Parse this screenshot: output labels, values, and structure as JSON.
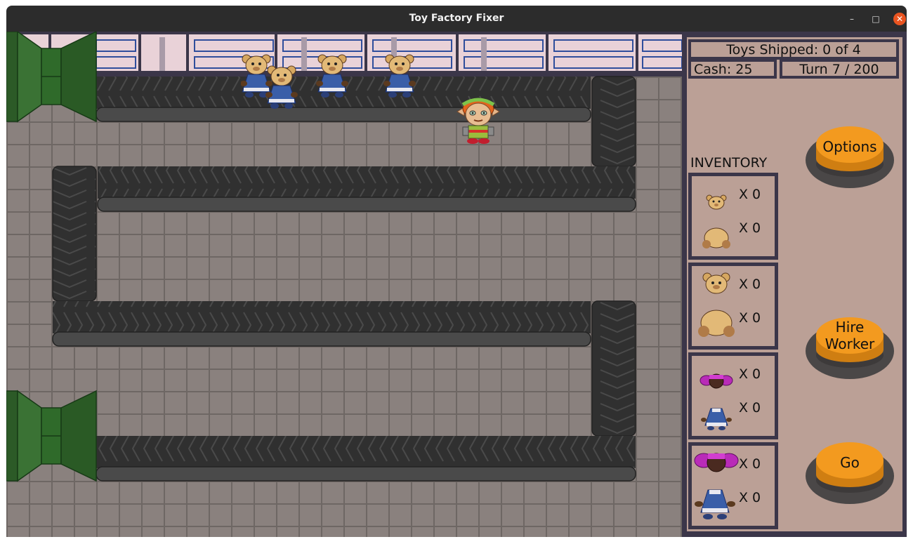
{
  "window": {
    "title": "Toy Factory Fixer",
    "minimize": "–",
    "maximize": "□",
    "close": "✕"
  },
  "hud": {
    "toys_shipped": "Toys Shipped: 0 of 4",
    "cash": "Cash: 25",
    "turn": "Turn 7 / 200",
    "inventory_title": "INVENTORY",
    "inventory": [
      {
        "items": [
          {
            "icon": "small-bear-head-icon",
            "count": "X 0"
          },
          {
            "icon": "small-bear-body-icon",
            "count": "X 0"
          }
        ]
      },
      {
        "items": [
          {
            "icon": "bear-head-icon",
            "count": "X 0"
          },
          {
            "icon": "bear-body-icon",
            "count": "X 0"
          }
        ]
      },
      {
        "items": [
          {
            "icon": "small-doll-head-icon",
            "count": "X 0"
          },
          {
            "icon": "small-doll-dress-icon",
            "count": "X 0"
          }
        ]
      },
      {
        "items": [
          {
            "icon": "doll-head-icon",
            "count": "X 0"
          },
          {
            "icon": "doll-dress-icon",
            "count": "X 0"
          }
        ]
      }
    ],
    "buttons": {
      "options": "Options",
      "hire_line1": "Hire",
      "hire_line2": "Worker",
      "go": "Go"
    }
  },
  "colors": {
    "button_orange": "#f39a1f",
    "panel_bg": "#bba096",
    "panel_border": "#3b3649",
    "conveyor": "#333333",
    "pipe_green": "#2f5f2a"
  }
}
